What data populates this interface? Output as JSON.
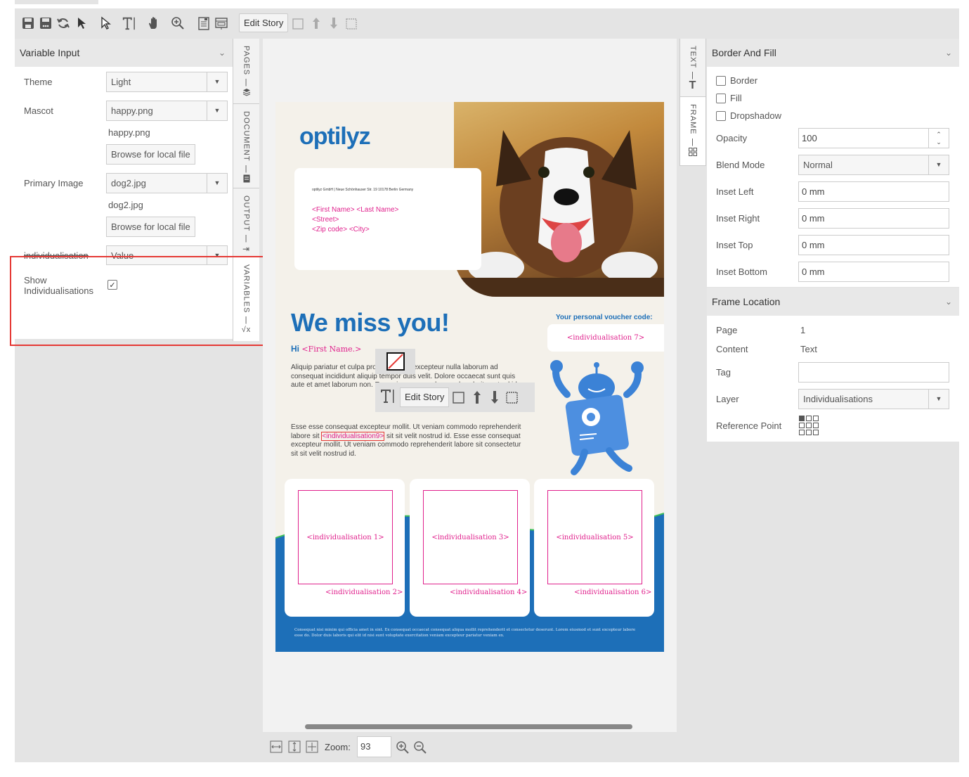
{
  "toolbar": {
    "edit_story": "Edit Story"
  },
  "left_panel": {
    "title": "Variable Input",
    "theme_label": "Theme",
    "theme_value": "Light",
    "mascot_label": "Mascot",
    "mascot_value": "happy.png",
    "mascot_file": "happy.png",
    "browse_label": "Browse for local file",
    "primary_label": "Primary Image",
    "primary_value": "dog2.jpg",
    "primary_file": "dog2.jpg",
    "browse_label2": "Browse for local file",
    "indiv_label": "individualisation",
    "indiv_value": "Value",
    "show_label": "Show Individualisations"
  },
  "side_tabs": {
    "pages": "PAGES",
    "document": "DOCUMENT",
    "output": "OUTPUT",
    "variables": "VARIABLES"
  },
  "right_tabs": {
    "text": "TEXT",
    "frame": "FRAME"
  },
  "canvas": {
    "logo": "optilyz",
    "sender": "optilyz GmbH | Neue Schönhauser Str. 19 10178 Berlin Germany",
    "addr1": "<First Name> <Last Name>",
    "addr2": "<Street>",
    "addr3": "<Zip code> <City>",
    "headline": "We miss you!",
    "hi": "Hi",
    "hi_name": "<First Name.>",
    "voucher_title": "Your personal voucher code:",
    "voucher_value": "<individualisation 7>",
    "para1": "Aliquip pariatur et culpa proident. Anim excepteur nulla laborum ad consequat incididunt aliquip tempor duis velit. Dolore occaecat sunt quis aute et amet laborum non. Es veniam commodo reprehenderit nostrud id.",
    "para2a": "Esse esse consequat excepteur mollit. Ut veniam commodo reprehenderit labore sit ",
    "para2_tag": "<individualisation9>",
    "para2b": " sit sit velit nostrud id. Esse esse consequat excepteur mollit. Ut veniam commodo reprehenderit labore sit consectetur sit sit velit nostrud id.",
    "edit_story": "Edit Story",
    "ind1": "<individualisation 1>",
    "ind2": "<individualisation 2>",
    "ind3": "<individualisation 3>",
    "ind4": "<individualisation 4>",
    "ind5": "<individualisation 5>",
    "ind6": "<individualisation 6>",
    "footer": "Consequat nisi minim qui officia amet in sint. Ex consequat occaecat consequat aliqua mollit reprehenderit et consectetur deserunt. Lorem eiusmod et sunt excepteur labore esse do. Dolor duis laboris qui elit id nisi sunt voluptate exercitation veniam excepteur pariatur veniam ex."
  },
  "bottom": {
    "zoom_label": "Zoom:",
    "zoom_value": "93"
  },
  "border_fill": {
    "title": "Border And Fill",
    "border": "Border",
    "fill": "Fill",
    "dropshadow": "Dropshadow",
    "opacity_label": "Opacity",
    "opacity_value": "100",
    "blend_label": "Blend Mode",
    "blend_value": "Normal",
    "inset_left_label": "Inset Left",
    "inset_left": "0 mm",
    "inset_right_label": "Inset Right",
    "inset_right": "0 mm",
    "inset_top_label": "Inset Top",
    "inset_top": "0 mm",
    "inset_bottom_label": "Inset Bottom",
    "inset_bottom": "0 mm"
  },
  "frame_location": {
    "title": "Frame Location",
    "page_label": "Page",
    "page_value": "1",
    "content_label": "Content",
    "content_value": "Text",
    "tag_label": "Tag",
    "tag_value": "",
    "layer_label": "Layer",
    "layer_value": "Individualisations",
    "ref_label": "Reference Point"
  },
  "colors": {
    "brand_blue": "#1d6fb8",
    "pink": "#e0208c",
    "highlight_red": "#e53935"
  }
}
